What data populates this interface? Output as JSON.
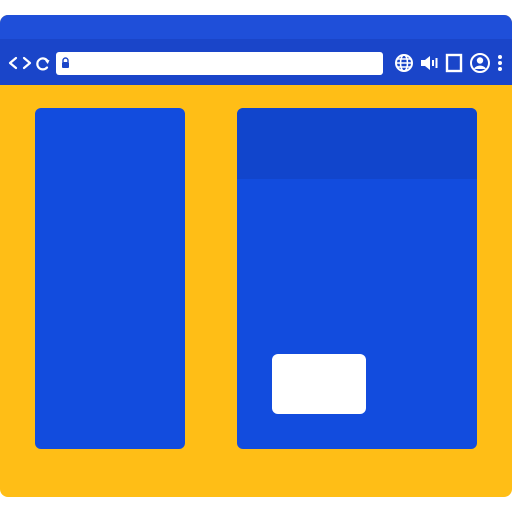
{
  "browser": {
    "address": {
      "value": ""
    },
    "icons": {
      "back": "chevron-left-icon",
      "forward": "chevron-right-icon",
      "reload": "reload-icon",
      "lock": "lock-icon",
      "globe": "globe-icon",
      "volume": "volume-icon",
      "window": "window-icon",
      "profile": "user-icon",
      "menu": "kebab-menu-icon"
    }
  },
  "colors": {
    "frame": "#FFBE16",
    "titlebar": "#1F4FD9",
    "toolbar": "#1A45C9",
    "panel": "#124CDE",
    "panel_header": "#1145CC",
    "card": "#FFFFFF"
  }
}
